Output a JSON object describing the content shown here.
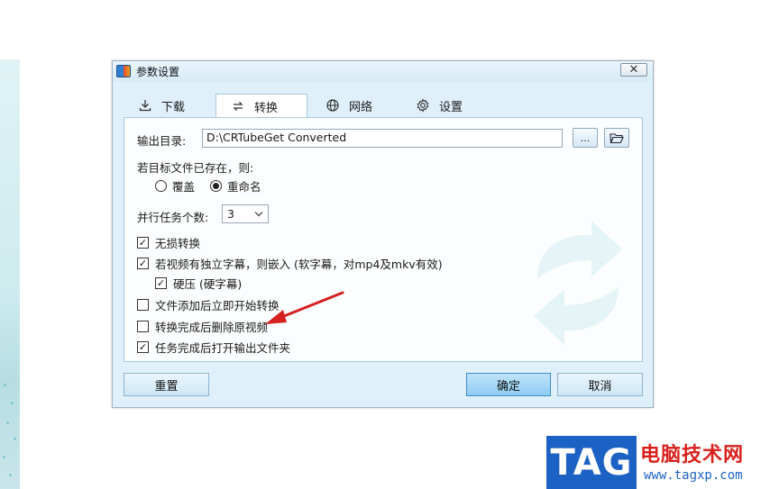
{
  "dialog": {
    "title": "参数设置",
    "close_label": "✕"
  },
  "tabs": [
    {
      "label": "下载",
      "icon": "download-icon"
    },
    {
      "label": "转换",
      "icon": "convert-icon",
      "active": true
    },
    {
      "label": "网络",
      "icon": "globe-icon"
    },
    {
      "label": "设置",
      "icon": "gear-icon"
    }
  ],
  "output": {
    "label": "输出目录:",
    "path": "D:\\CRTubeGet Converted",
    "browse_label": "...",
    "open_folder_icon": "folder-open-icon"
  },
  "exists": {
    "label": "若目标文件已存在，则:",
    "options": [
      {
        "label": "覆盖",
        "selected": false
      },
      {
        "label": "重命名",
        "selected": true
      }
    ]
  },
  "parallel": {
    "label": "并行任务个数:",
    "value": "3"
  },
  "checkboxes": [
    {
      "label": "无损转换",
      "checked": true
    },
    {
      "label": "若视频有独立字幕，则嵌入 (软字幕，对mp4及mkv有效)",
      "checked": true
    },
    {
      "label": "硬压 (硬字幕)",
      "checked": true
    },
    {
      "label": "文件添加后立即开始转换",
      "checked": false
    },
    {
      "label": "转换完成后删除原视频",
      "checked": false
    },
    {
      "label": "任务完成后打开输出文件夹",
      "checked": true
    }
  ],
  "buttons": {
    "reset": "重置",
    "ok": "确定",
    "cancel": "取消"
  },
  "watermark": {
    "tag": "TAG",
    "title": "电脑技术网",
    "url": "www.tagxp.com"
  },
  "colors": {
    "accent": "#3d8fc8",
    "arrow": "#d42020",
    "logo_blue": "#1c62c4",
    "logo_red": "#d8211d"
  }
}
